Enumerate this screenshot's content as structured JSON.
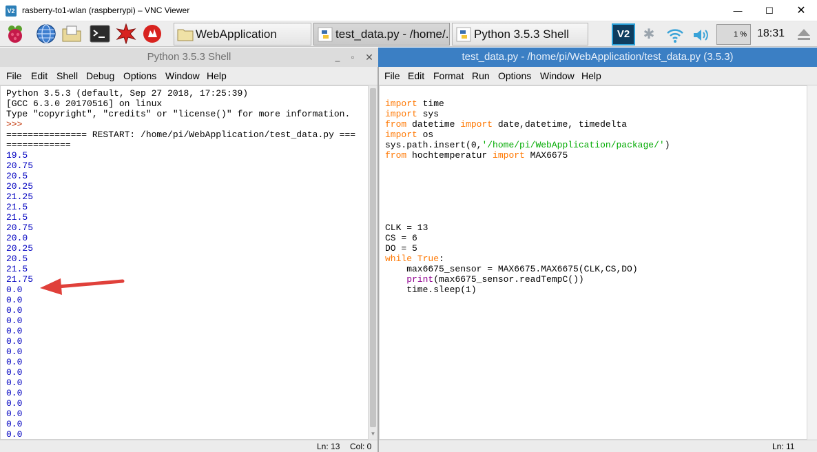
{
  "vnc": {
    "title": "rasberry-to1-wlan (raspberrypi) – VNC Viewer",
    "logo": "V2",
    "min_glyph": "—",
    "max_glyph": "☐",
    "close_glyph": "✕"
  },
  "taskbar": {
    "launchers": [
      "raspberry-menu-icon",
      "globe-icon",
      "files-icon",
      "terminal-icon",
      "mathematica-icon",
      "wolfram-icon"
    ],
    "tasks": {
      "webapp": "WebApplication",
      "testdata": "test_data.py - /home/...",
      "shell": "Python 3.5.3 Shell"
    },
    "vnc_tray": "V2",
    "bluetooth": "✱",
    "cpu": "1 %",
    "clock": "18:31"
  },
  "left_window": {
    "title": "Python 3.5.3 Shell",
    "controls": {
      "min": "_",
      "max": "▫",
      "close": "✕"
    },
    "menu": [
      "File",
      "Edit",
      "Shell",
      "Debug",
      "Options",
      "Window",
      "Help"
    ],
    "header_lines": [
      "Python 3.5.3 (default, Sep 27 2018, 17:25:39)",
      "[GCC 6.3.0 20170516] on linux",
      "Type \"copyright\", \"credits\" or \"license()\" for more information."
    ],
    "prompt": ">>>",
    "restart_line": "=============== RESTART: /home/pi/WebApplication/test_data.py ===",
    "restart_wrap": "============",
    "output": [
      "19.5",
      "20.75",
      "20.5",
      "20.25",
      "21.25",
      "21.5",
      "21.5",
      "20.75",
      "20.0",
      "20.25",
      "20.5",
      "21.5",
      "21.75",
      "0.0",
      "0.0",
      "0.0",
      "0.0",
      "0.0",
      "0.0",
      "0.0",
      "0.0",
      "0.0",
      "0.0",
      "0.0",
      "0.0",
      "0.0",
      "0.0",
      "0.0"
    ],
    "status": {
      "ln": "Ln: 13",
      "col": "Col: 0"
    }
  },
  "right_window": {
    "title": "test_data.py - /home/pi/WebApplication/test_data.py (3.5.3)",
    "menu": [
      "File",
      "Edit",
      "Format",
      "Run",
      "Options",
      "Window",
      "Help"
    ],
    "code": {
      "l1_kw": "import",
      "l1_rest": " time",
      "l2_kw": "import",
      "l2_rest": " sys",
      "l3_kw1": "from",
      "l3_mid": " datetime ",
      "l3_kw2": "import",
      "l3_rest": " date,datetime, timedelta",
      "l4_kw": "import",
      "l4_rest": " os",
      "l5_pre": "sys.path.insert(0,",
      "l5_str": "'/home/pi/WebApplication/package/'",
      "l5_post": ")",
      "l6_kw1": "from",
      "l6_mid": " hochtemperatur ",
      "l6_kw2": "import",
      "l6_rest": " MAX6675",
      "l7": "CLK = 13",
      "l8": "CS = 6",
      "l9": "DO = 5",
      "l10_kw": "while",
      "l10_sp": " ",
      "l10_kw2": "True",
      "l10_rest": ":",
      "l11": "    max6675_sensor = MAX6675.MAX6675(CLK,CS,DO)",
      "l12_ind": "    ",
      "l12_bi": "print",
      "l12_rest": "(max6675_sensor.readTempC())",
      "l13": "    time.sleep(1)"
    },
    "status": {
      "ln": "Ln: 11"
    }
  },
  "colors": {
    "shell_output": "#0000c0",
    "keyword": "#ff7700",
    "builtin": "#900090",
    "string": "#00aa00",
    "active_title": "#3b7fc4",
    "arrow": "#e0403a"
  }
}
